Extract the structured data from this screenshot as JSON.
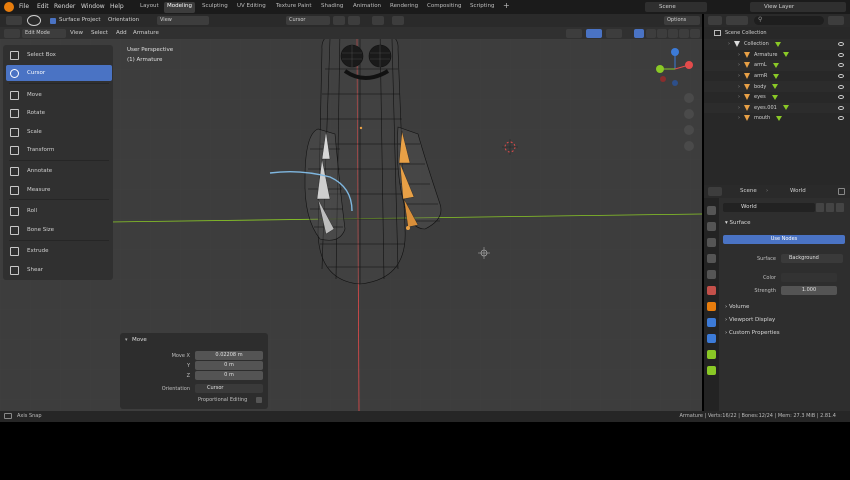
{
  "menu": [
    "File",
    "Edit",
    "Render",
    "Window",
    "Help"
  ],
  "workspaces": [
    "Layout",
    "Modeling",
    "Sculpting",
    "UV Editing",
    "Texture Paint",
    "Shading",
    "Animation",
    "Rendering",
    "Compositing",
    "Scripting"
  ],
  "active_workspace": "Modeling",
  "scene_name": "Scene",
  "view_layer": "View Layer",
  "header": {
    "surface_project": "Surface Project",
    "orientation_label": "Orientation",
    "orientation_value": "View",
    "pivot": "Cursor",
    "options": "Options",
    "mode": "Edit Mode",
    "view": "View",
    "select": "Select",
    "add": "Add",
    "armature": "Armature"
  },
  "viewport": {
    "perspective": "User Perspective",
    "object": "(1) Armature"
  },
  "tools": [
    {
      "label": "Select Box",
      "icon": "select-box-icon"
    },
    {
      "label": "Cursor",
      "icon": "cursor-icon",
      "active": true
    },
    {
      "label": "Move",
      "icon": "move-icon"
    },
    {
      "label": "Rotate",
      "icon": "rotate-icon"
    },
    {
      "label": "Scale",
      "icon": "scale-icon"
    },
    {
      "label": "Transform",
      "icon": "transform-icon"
    },
    {
      "label": "Annotate",
      "icon": "annotate-icon"
    },
    {
      "label": "Measure",
      "icon": "measure-icon"
    },
    {
      "label": "Roll",
      "icon": "roll-icon"
    },
    {
      "label": "Bone Size",
      "icon": "bone-size-icon"
    },
    {
      "label": "Extrude",
      "icon": "extrude-icon"
    },
    {
      "label": "Shear",
      "icon": "shear-icon"
    }
  ],
  "operator": {
    "title": "Move",
    "move_x_label": "Move X",
    "move_x_value": "0.02208 m",
    "y_label": "Y",
    "y_value": "0 m",
    "z_label": "Z",
    "z_value": "0 m",
    "orientation_label": "Orientation",
    "orientation_value": "Cursor",
    "proportional": "Proportional Editing"
  },
  "statusbar": {
    "left": "Axis Snap",
    "right": "Armature | Verts:16/22 | Bones:12/24 | Mem: 27.3 MiB | 2.81.4"
  },
  "outliner": {
    "root": "Scene Collection",
    "items": [
      {
        "label": "Collection",
        "depth": 1
      },
      {
        "label": "Armature",
        "depth": 2
      },
      {
        "label": "armL",
        "depth": 2
      },
      {
        "label": "armR",
        "depth": 2
      },
      {
        "label": "body",
        "depth": 2
      },
      {
        "label": "eyes",
        "depth": 2
      },
      {
        "label": "eyes.001",
        "depth": 2
      },
      {
        "label": "mouth",
        "depth": 2
      }
    ]
  },
  "properties": {
    "scene_tab": "Scene",
    "world_tab": "World",
    "world_name": "World",
    "surface_section": "Surface",
    "use_nodes": "Use Nodes",
    "surface_label": "Surface",
    "surface_value": "Background",
    "color_label": "Color",
    "strength_label": "Strength",
    "strength_value": "1.000",
    "sections": [
      "Volume",
      "Viewport Display",
      "Custom Properties"
    ]
  },
  "colors": {
    "accent": "#4a73c4",
    "x_axis": "#e34b4b",
    "y_axis": "#8ac926",
    "z_axis": "#3c7bd8",
    "bone_active": "#e8a046"
  }
}
